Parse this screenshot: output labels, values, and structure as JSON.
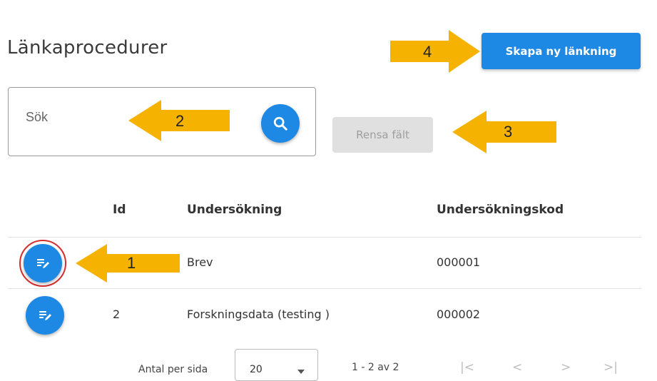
{
  "page": {
    "title": "Länkaprocedurer"
  },
  "toolbar": {
    "create_label": "Skapa ny länkning",
    "clear_label": "Rensa fält"
  },
  "search": {
    "placeholder": "Sök"
  },
  "table": {
    "headers": {
      "id": "Id",
      "exam": "Undersökning",
      "code": "Undersökningskod"
    },
    "rows": [
      {
        "id": "",
        "exam": "Brev",
        "code": "000001"
      },
      {
        "id": "2",
        "exam": "Forskningsdata (testing )",
        "code": "000002"
      }
    ]
  },
  "pagination": {
    "per_page_label": "Antal per sida",
    "per_page_value": "20",
    "range": "1 - 2 av 2",
    "first": "|<",
    "prev": "<",
    "next": ">",
    "last": ">|"
  },
  "annotations": {
    "n1": "1",
    "n2": "2",
    "n3": "3",
    "n4": "4"
  },
  "colors": {
    "primary": "#1e88e5",
    "arrow": "#f5b300",
    "highlight": "#d32f2f"
  }
}
